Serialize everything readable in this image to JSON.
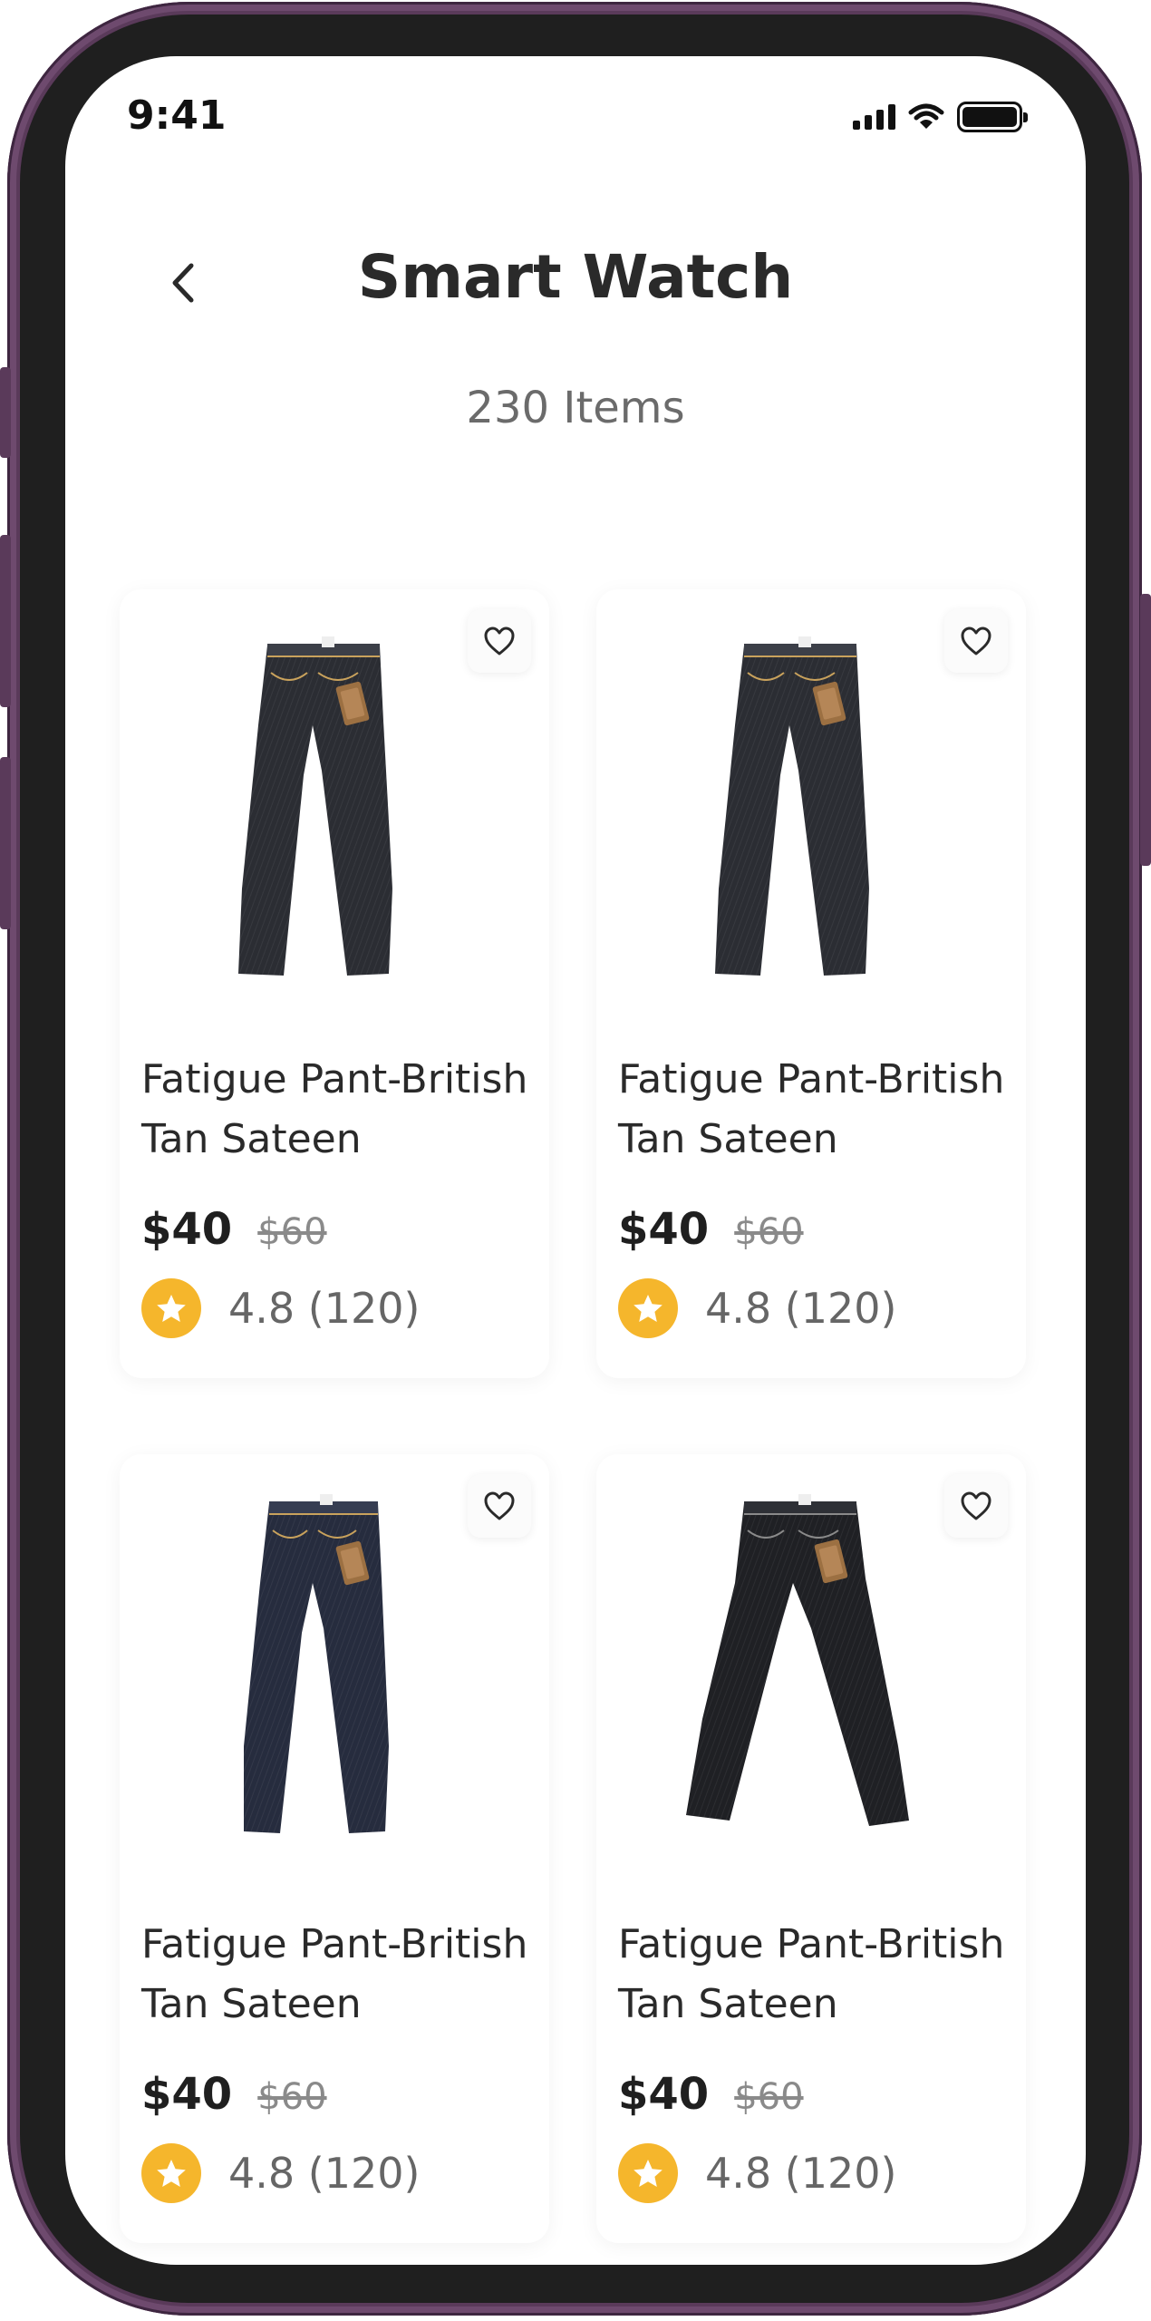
{
  "status_bar": {
    "time": "9:41"
  },
  "header": {
    "title": "Smart Watch",
    "item_count": "230 Items"
  },
  "colors": {
    "frame": "#5a3a5a",
    "star": "#f5b62c",
    "denim_dark": "#2b2d33",
    "denim_blue": "#262c3e"
  },
  "products": [
    {
      "name": "Fatigue Pant-British Tan Sateen",
      "price": "$40",
      "old_price": "$60",
      "rating": "4.8 (120)",
      "image": "jeans-dark-grey"
    },
    {
      "name": "Fatigue Pant-British Tan Sateen",
      "price": "$40",
      "old_price": "$60",
      "rating": "4.8 (120)",
      "image": "jeans-dark-grey"
    },
    {
      "name": "Fatigue Pant-British Tan Sateen",
      "price": "$40",
      "old_price": "$60",
      "rating": "4.8 (120)",
      "image": "jeans-indigo"
    },
    {
      "name": "Fatigue Pant-British Tan Sateen",
      "price": "$40",
      "old_price": "$60",
      "rating": "4.8 (120)",
      "image": "jeans-black"
    }
  ]
}
